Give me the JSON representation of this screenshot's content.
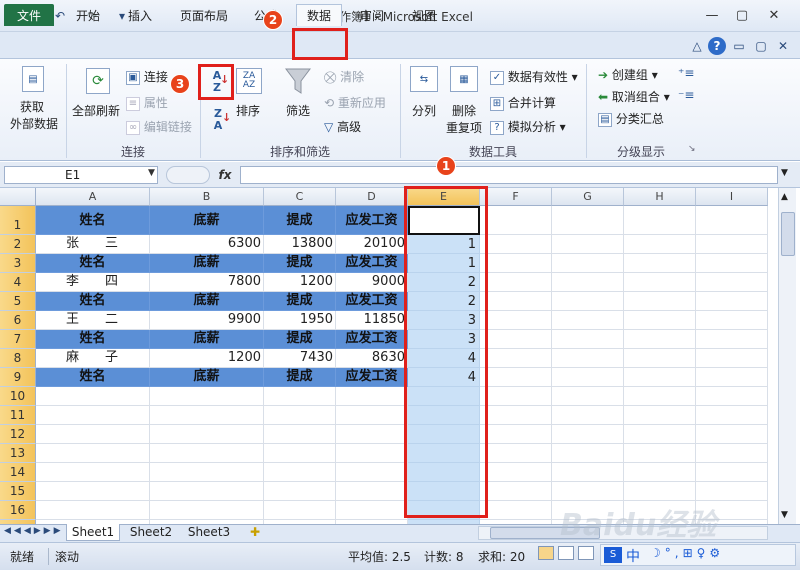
{
  "window": {
    "title": "工作簿1 - Microsoft Excel",
    "minimize": "▭",
    "restore": "▢",
    "close": "✕"
  },
  "quick_access": {
    "save": "💾",
    "undo": "↶",
    "redo": "↷",
    "more": "▾"
  },
  "tabs": [
    "文件",
    "开始",
    "插入",
    "页面布局",
    "公式",
    "数据",
    "审阅",
    "视图"
  ],
  "ribbon_right_icons": {
    "expand": "△",
    "help": "?",
    "min": "▭",
    "restore": "▢",
    "close": "✕"
  },
  "ribbon": {
    "get_external": [
      "获取",
      "外部数据"
    ],
    "refresh_all": "全部刷新",
    "connections": "连接",
    "properties": "属性",
    "edit_links": "编辑链接",
    "group_connections": "连接",
    "sort": "排序",
    "filter": "筛选",
    "clear": "清除",
    "reapply": "重新应用",
    "advanced": "高级",
    "group_sort": "排序和筛选",
    "text_to_columns": "分列",
    "remove_dup": [
      "删除",
      "重复项"
    ],
    "data_validation": "数据有效性",
    "consolidate": "合并计算",
    "what_if": "模拟分析",
    "group_tools": "数据工具",
    "group": "创建组",
    "ungroup": "取消组合",
    "subtotal": "分类汇总",
    "group_outline": "分级显示"
  },
  "name_box": "E1",
  "fx": "fx",
  "columns": [
    "A",
    "B",
    "C",
    "D",
    "E",
    "F",
    "G",
    "H",
    "I"
  ],
  "rows": [
    "1",
    "2",
    "3",
    "4",
    "5",
    "6",
    "7",
    "8",
    "9",
    "10",
    "11",
    "12",
    "13",
    "14",
    "15",
    "16",
    "17"
  ],
  "header_row": [
    "姓名",
    "底薪",
    "提成",
    "应发工资"
  ],
  "data": [
    {
      "name": "张　　三",
      "base": "6300",
      "comm": "13800",
      "total": "20100",
      "e": "1"
    },
    {
      "name": "李　　四",
      "base": "7800",
      "comm": "1200",
      "total": "9000",
      "e": "2"
    },
    {
      "name": "王　　二",
      "base": "9900",
      "comm": "1950",
      "total": "11850",
      "e": "3"
    },
    {
      "name": "麻　　子",
      "base": "1200",
      "comm": "7430",
      "total": "8630",
      "e": "4"
    }
  ],
  "header_e": [
    "",
    "1",
    "2",
    "3",
    "4"
  ],
  "sheets": [
    "Sheet1",
    "Sheet2",
    "Sheet3"
  ],
  "status": {
    "ready": "就绪",
    "scroll": "滚动",
    "avg": "平均值: 2.5",
    "count": "计数: 8",
    "sum": "求和: 20"
  },
  "callouts": [
    "1",
    "2",
    "3"
  ],
  "watermark": "Baidu经验",
  "ime": "中"
}
